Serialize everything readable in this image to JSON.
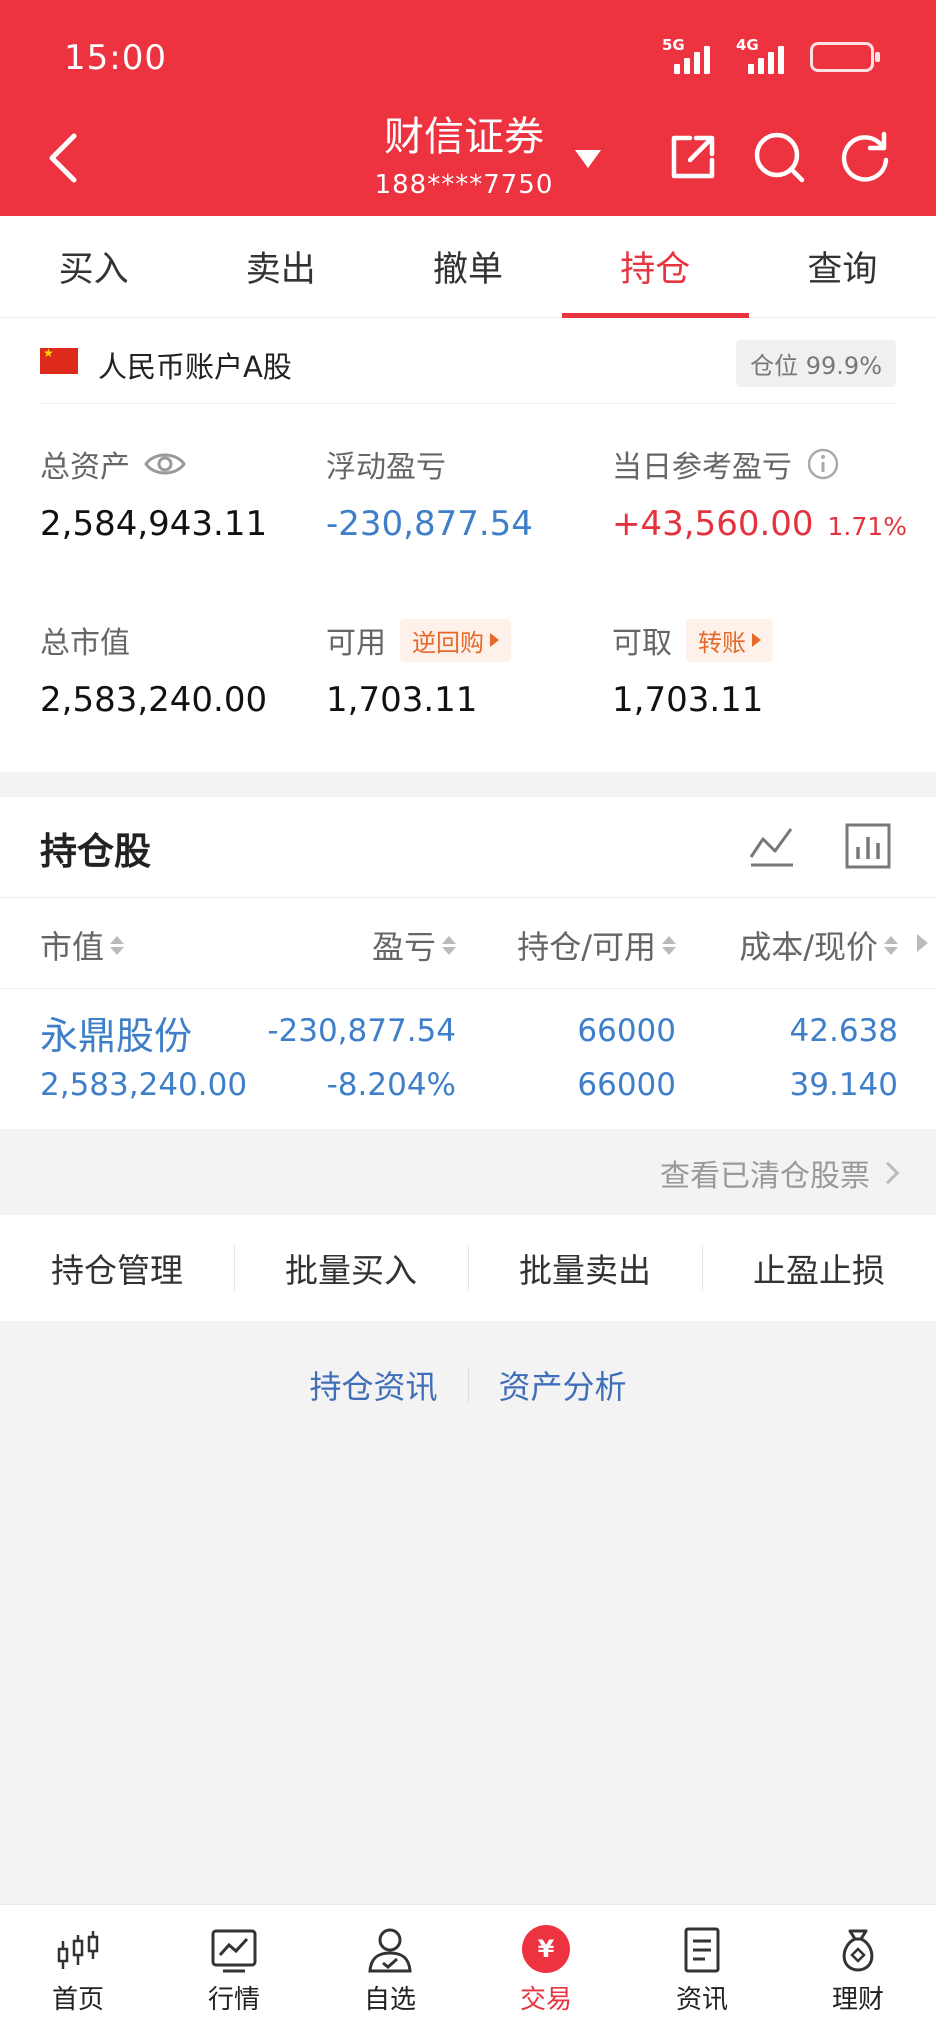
{
  "status_bar": {
    "time": "15:00",
    "signal_1": "5G",
    "signal_2": "4G"
  },
  "header": {
    "broker_name": "财信证券",
    "account": "188****7750"
  },
  "tabs": [
    {
      "label": "买入"
    },
    {
      "label": "卖出"
    },
    {
      "label": "撤单"
    },
    {
      "label": "持仓",
      "active": true
    },
    {
      "label": "查询"
    }
  ],
  "account": {
    "name": "人民币账户A股",
    "position_label": "仓位 99.9%",
    "total_assets_label": "总资产",
    "total_assets": "2,584,943.11",
    "floating_pl_label": "浮动盈亏",
    "floating_pl": "-230,877.54",
    "daily_pl_label": "当日参考盈亏",
    "daily_pl": "+43,560.00",
    "daily_pl_pct": "1.71%",
    "market_value_label": "总市值",
    "market_value": "2,583,240.00",
    "available_label": "可用",
    "available_chip": "逆回购",
    "available": "1,703.11",
    "withdrawable_label": "可取",
    "withdrawable_chip": "转账",
    "withdrawable": "1,703.11"
  },
  "holdings": {
    "title": "持仓股",
    "columns": [
      "市值",
      "盈亏",
      "持仓/可用",
      "成本/现价"
    ],
    "rows": [
      {
        "name": "永鼎股份",
        "market_value": "2,583,240.00",
        "pl": "-230,877.54",
        "pl_pct": "-8.204%",
        "position": "66000",
        "available": "66000",
        "cost": "42.638",
        "price": "39.140"
      }
    ],
    "cleared_link": "查看已清仓股票"
  },
  "actions": [
    "持仓管理",
    "批量买入",
    "批量卖出",
    "止盈止损"
  ],
  "links": [
    "持仓资讯",
    "资产分析"
  ],
  "bottom_nav": [
    {
      "label": "首页",
      "icon": "candlestick-icon"
    },
    {
      "label": "行情",
      "icon": "chart-icon"
    },
    {
      "label": "自选",
      "icon": "user-check-icon"
    },
    {
      "label": "交易",
      "icon": "yuan-icon",
      "glyph": "¥",
      "active": true
    },
    {
      "label": "资讯",
      "icon": "document-icon"
    },
    {
      "label": "理财",
      "icon": "money-bag-icon"
    }
  ],
  "colors": {
    "header_bg": "#ee3340",
    "accent_red": "#e3333e",
    "accent_blue": "#3f7fc9",
    "chip_orange": "#e6692c"
  }
}
